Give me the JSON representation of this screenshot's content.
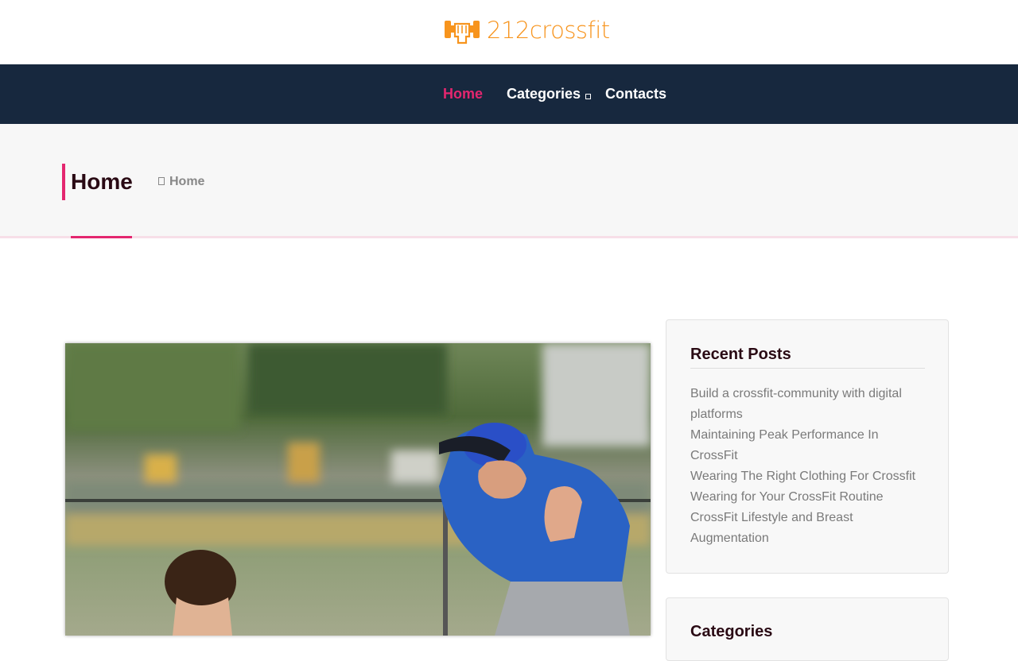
{
  "header": {
    "logo_text": "212crossfit",
    "logo_icon": "dumbbell-hand-icon",
    "brand_color": "#f7941d"
  },
  "nav": {
    "items": [
      {
        "label": "Home",
        "active": true
      },
      {
        "label": "Categories",
        "has_dropdown": true,
        "dropdown_icon": "chevron-down-icon"
      },
      {
        "label": "Contacts"
      }
    ],
    "background": "#17283e",
    "active_color": "#e4266f"
  },
  "page": {
    "title": "Home",
    "breadcrumb": {
      "icon": "home-icon",
      "label": "Home"
    }
  },
  "main": {
    "image_icon": "coach-and-boy-baseball-photo"
  },
  "sidebar": {
    "recent_posts": {
      "title": "Recent Posts",
      "items": [
        "Build a crossfit-community with digital platforms",
        "Maintaining Peak Performance In CrossFit",
        "Wearing The Right Clothing For Crossfit",
        "Wearing for Your CrossFit Routine",
        "CrossFit Lifestyle and Breast Augmentation"
      ]
    },
    "categories": {
      "title": "Categories"
    }
  }
}
